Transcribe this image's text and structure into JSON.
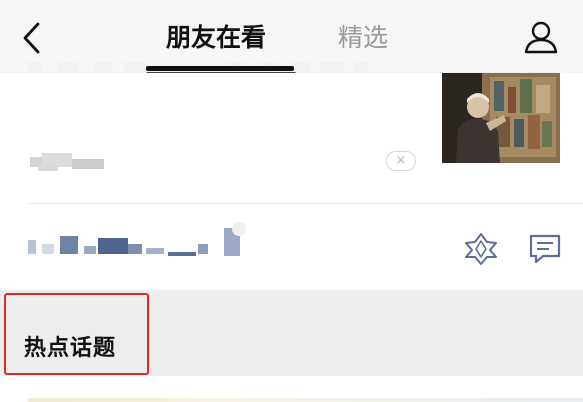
{
  "nav": {
    "back_icon": "back-chevron-icon",
    "tabs": [
      {
        "label": "朋友在看",
        "active": true
      },
      {
        "label": "精选",
        "active": false
      }
    ],
    "profile_icon": "user-profile-icon"
  },
  "article": {
    "thumbnail": "elderly-man-viewing-painting-photo",
    "dismiss_label": "×"
  },
  "reaction_row": {
    "wow_icon": "wow-star-icon",
    "comment_icon": "comment-icon"
  },
  "topics": {
    "title": "热点话题"
  },
  "colors": {
    "accent_highlight": "#e02828",
    "section_bg": "#ededed",
    "inactive_tab": "#9a9a9a"
  }
}
